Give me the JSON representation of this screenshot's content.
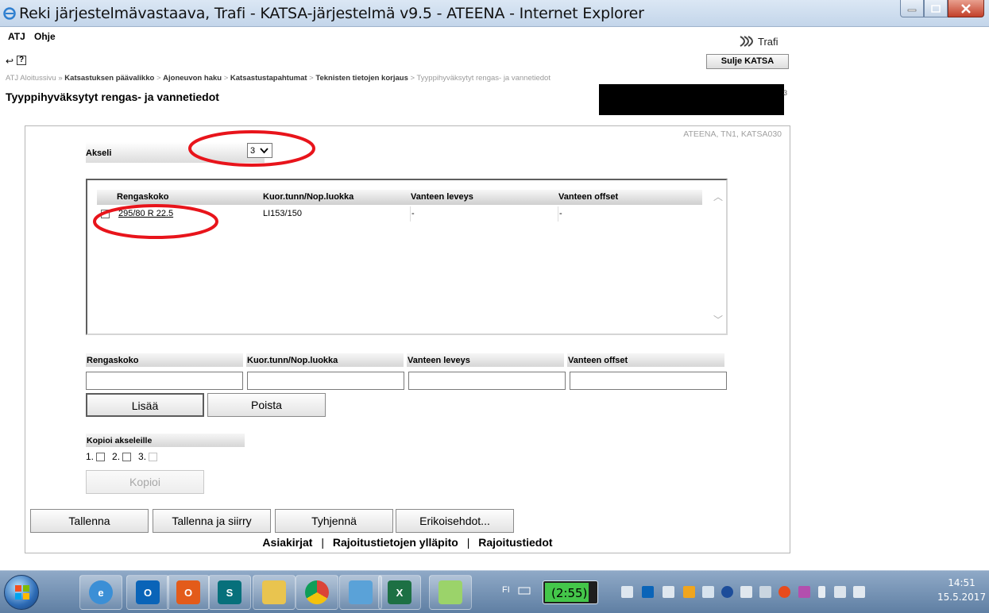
{
  "window": {
    "title": "Reki järjestelmävastaava, Trafi - KATSA-järjestelmä v9.5 - ATEENA - Internet Explorer"
  },
  "menu": {
    "items": [
      "ATJ",
      "Ohje"
    ]
  },
  "logo": {
    "text": "Trafi"
  },
  "toolbar": {
    "close_label": "Sulje KATSA"
  },
  "breadcrumb": {
    "items": [
      "ATJ Aloitussivu",
      "Katsastuksen päävalikko",
      "Ajoneuvon haku",
      "Katsastustapahtumat",
      "Teknisten tietojen korjaus",
      "Tyyppihyväksytyt rengas- ja vannetiedot"
    ],
    "sep_first": "»",
    "sep": ">"
  },
  "page": {
    "title": "Tyyppihyväksytyt rengas- ja vannetiedot",
    "system_id": "ATEENA, TN1, KATSA030",
    "redacted_tail": "3"
  },
  "axle": {
    "label": "Akseli",
    "value": "3"
  },
  "list": {
    "columns": [
      "Rengaskoko",
      "Kuor.tunn/Nop.luokka",
      "Vanteen leveys",
      "Vanteen offset"
    ],
    "rows": [
      {
        "size": "295/80 R 22.5",
        "load": "LI153/150",
        "width": "-",
        "offset": "-"
      }
    ]
  },
  "entry": {
    "columns": [
      "Rengaskoko",
      "Kuor.tunn/Nop.luokka",
      "Vanteen leveys",
      "Vanteen offset"
    ],
    "values": [
      "",
      "",
      "",
      ""
    ],
    "add_label": "Lisää",
    "remove_label": "Poista"
  },
  "copy": {
    "title": "Kopioi akseleille",
    "axles": [
      "1.",
      "2.",
      "3."
    ],
    "button_label": "Kopioi"
  },
  "actions": {
    "save": "Tallenna",
    "save_move": "Tallenna ja siirry",
    "clear": "Tyhjennä",
    "special": "Erikoisehdot..."
  },
  "links": {
    "items": [
      "Asiakirjat",
      "Rajoitustietojen ylläpito",
      "Rajoitustiedot"
    ],
    "sep": "|"
  },
  "taskbar": {
    "language": "FI",
    "battery_label": "(2:55)",
    "battery_level": 0.83,
    "time": "14:51",
    "date": "15.5.2017"
  },
  "colors": {
    "highlight_ellipse": "#e8141b",
    "title_bar": "#c3d5ea"
  }
}
